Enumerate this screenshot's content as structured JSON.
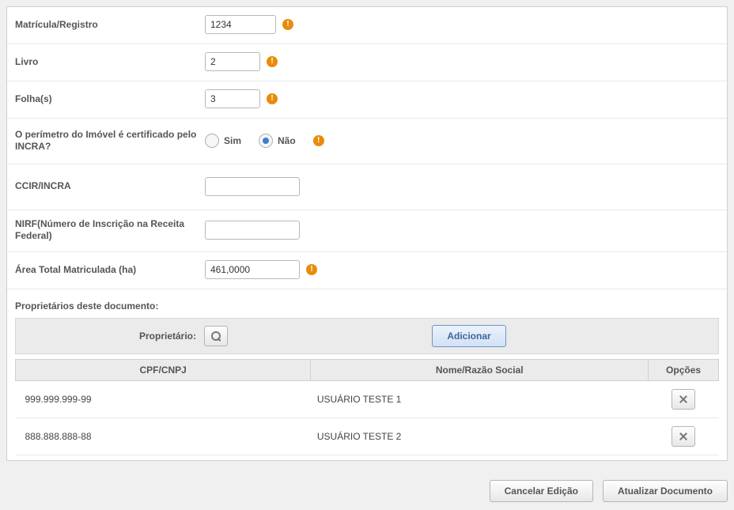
{
  "form": {
    "matricula": {
      "label": "Matrícula/Registro",
      "value": "1234"
    },
    "livro": {
      "label": "Livro",
      "value": "2"
    },
    "folhas": {
      "label": "Folha(s)",
      "value": "3"
    },
    "perimetro": {
      "label": "O perímetro do Imóvel é certificado pelo INCRA?",
      "opt_sim": "Sim",
      "opt_nao": "Não",
      "value": "nao"
    },
    "ccir_incra": {
      "label": "CCIR/INCRA",
      "value": ""
    },
    "nirf": {
      "label": "NIRF(Número de Inscrição na Receita Federal)",
      "value": ""
    },
    "area_total": {
      "label": "Área Total Matriculada (ha)",
      "value": "461,0000"
    }
  },
  "owners": {
    "section_title": "Proprietários deste documento:",
    "filter_label": "Proprietário:",
    "add_label": "Adicionar",
    "columns": {
      "cpf": "CPF/CNPJ",
      "nome": "Nome/Razão Social",
      "opcoes": "Opções"
    },
    "rows": [
      {
        "cpf": "999.999.999-99",
        "nome": "USUÁRIO TESTE 1"
      },
      {
        "cpf": "888.888.888-88",
        "nome": "USUÁRIO TESTE 2"
      }
    ]
  },
  "footer": {
    "cancel": "Cancelar Edição",
    "update": "Atualizar Documento"
  }
}
